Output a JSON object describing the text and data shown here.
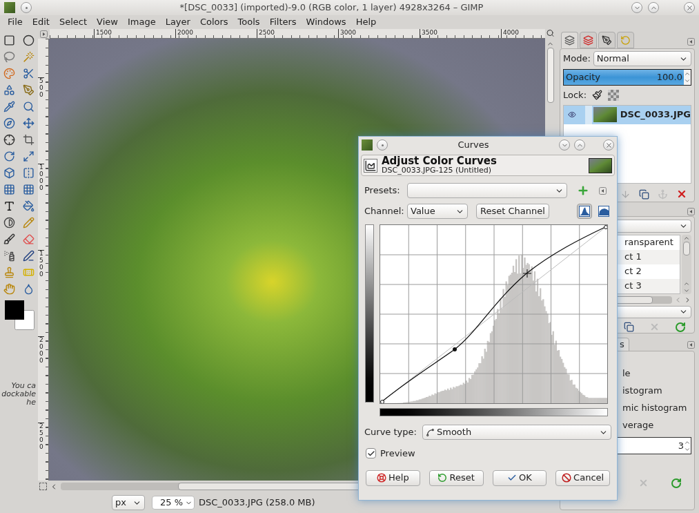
{
  "window": {
    "title": "*[DSC_0033] (imported)-9.0 (RGB color, 1 layer) 4928x3264 – GIMP"
  },
  "menu": [
    {
      "label": "File"
    },
    {
      "label": "Edit"
    },
    {
      "label": "Select"
    },
    {
      "label": "View"
    },
    {
      "label": "Image"
    },
    {
      "label": "Layer"
    },
    {
      "label": "Colors"
    },
    {
      "label": "Tools"
    },
    {
      "label": "Filters"
    },
    {
      "label": "Windows"
    },
    {
      "label": "Help"
    }
  ],
  "rulers": {
    "horizontal": [
      "1500",
      "2000",
      "2500",
      "3000",
      "3500",
      "4000"
    ],
    "vertical": [
      "500",
      "1000",
      "1500",
      "2000",
      "2500"
    ]
  },
  "toolbox": {
    "hint_lines": [
      "You ca",
      "dockable",
      "he"
    ]
  },
  "status_bar": {
    "unit": "px",
    "zoom": "25 %",
    "info": "DSC_0033.JPG (258.0 MB)"
  },
  "dock_tabs": [
    {
      "kind": "layers",
      "selected": true
    },
    {
      "kind": "channels",
      "selected": false
    },
    {
      "kind": "paths",
      "selected": false
    },
    {
      "kind": "undo",
      "selected": false
    }
  ],
  "layers_panel": {
    "mode_label": "Mode:",
    "mode": "Normal",
    "opacity": {
      "label": "Opacity",
      "value": "100.0",
      "level": 1
    },
    "lock_label": "Lock:",
    "layers": [
      {
        "name": "DSC_0033.JPG",
        "visible": true,
        "selected": true
      }
    ]
  },
  "second_panel": {
    "items": [
      {
        "label": "ransparent",
        "selected": false
      },
      {
        "label": "ct 1",
        "selected": false
      },
      {
        "label": "ct 2",
        "selected": false
      },
      {
        "label": "ct 3",
        "selected": false
      }
    ]
  },
  "third_panel": {
    "tab": "s",
    "options": [
      "le",
      "istogram",
      "mic histogram",
      "verage"
    ],
    "spin_value": "3"
  },
  "curves_dialog": {
    "title": "Curves",
    "heading": "Adjust Color Curves",
    "subtitle": "DSC_0033.JPG-125 (Untitled)",
    "presets_label": "Presets:",
    "channel_label": "Channel:",
    "channel": "Value",
    "reset_channel": "Reset Channel",
    "histogram_scale": [
      {
        "kind": "linear",
        "selected": true
      },
      {
        "kind": "log",
        "selected": false
      }
    ],
    "curve_type_label": "Curve type:",
    "curve_type": "Smooth",
    "preview": {
      "label": "Preview",
      "checked": true
    },
    "buttons": [
      {
        "label": "Help",
        "kind": "help"
      },
      {
        "label": "Reset",
        "kind": "reset"
      },
      {
        "label": "OK",
        "kind": "ok"
      },
      {
        "label": "Cancel",
        "kind": "cancel"
      }
    ]
  }
}
